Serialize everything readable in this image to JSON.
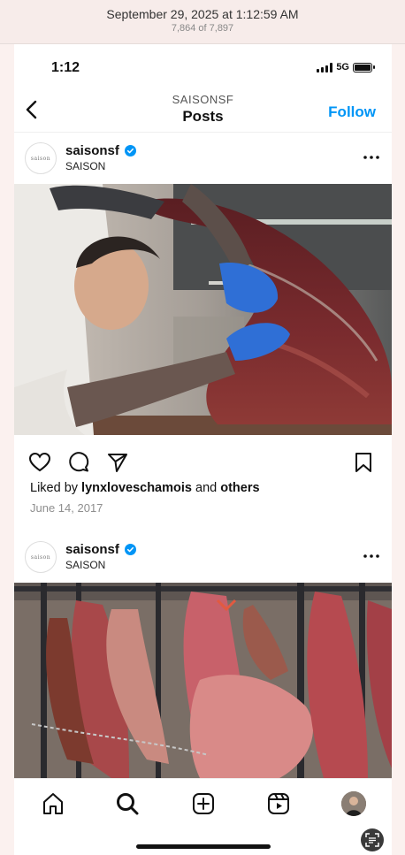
{
  "screenshot_meta": {
    "date": "September 29, 2025 at 1:12:59 AM",
    "count": "7,864 of 7,897"
  },
  "status_bar": {
    "time": "1:12",
    "network": "5G",
    "icons": [
      "signal-icon",
      "battery-icon"
    ]
  },
  "header": {
    "subtitle": "SAISONSF",
    "title": "Posts",
    "follow_label": "Follow",
    "back_icon": "chevron-left-icon"
  },
  "posts": [
    {
      "username": "saisonsf",
      "account_name": "SAISON",
      "avatar_text": "saison",
      "verified": true,
      "image_description_icon": "photo-chef-butchering-meat",
      "liked_by_prefix": "Liked by",
      "liked_by_user": "lynxloveschamois",
      "liked_by_and": "and",
      "liked_by_suffix": "others",
      "date": "June 14, 2017"
    },
    {
      "username": "saisonsf",
      "account_name": "SAISON",
      "avatar_text": "saison",
      "verified": true,
      "image_description_icon": "photo-hanging-meat-rack"
    }
  ],
  "actions": [
    "heart-icon",
    "comment-icon",
    "share-icon",
    "bookmark-icon"
  ],
  "tab_bar": [
    "home-icon",
    "search-icon",
    "create-icon",
    "reels-icon",
    "profile-avatar"
  ],
  "colors": {
    "accent": "#0095f6",
    "verified": "#0095f6",
    "header_bg": "#f7ecea"
  }
}
